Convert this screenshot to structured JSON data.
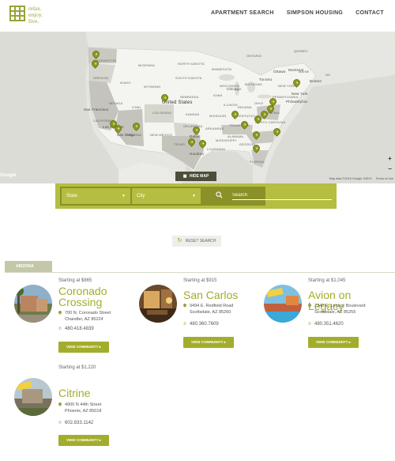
{
  "brand": {
    "logo_lines": [
      "relax.",
      "enjoy.",
      "live."
    ]
  },
  "nav": {
    "items": [
      "APARTMENT SEARCH",
      "SIMPSON HOUSING",
      "CONTACT"
    ]
  },
  "map": {
    "country_label": "United States",
    "states": [
      "WASHINGTON",
      "MONTANA",
      "NORTH DAKOTA",
      "MINNESOTA",
      "OREGON",
      "IDAHO",
      "WYOMING",
      "SOUTH DAKOTA",
      "WISCONSIN",
      "MICHIGAN",
      "NEBRASKA",
      "IOWA",
      "NEVADA",
      "UTAH",
      "COLORADO",
      "KANSAS",
      "MISSOURI",
      "ILLINOIS",
      "INDIANA",
      "OHIO",
      "PENNSYLVANIA",
      "CALIFORNIA",
      "ARIZONA",
      "NEW MEXICO",
      "OKLAHOMA",
      "ARKANSAS",
      "TENNESSEE",
      "NORTH CAROLINA",
      "TEXAS",
      "LOUISIANA",
      "MISSISSIPPI",
      "ALABAMA",
      "GEORGIA",
      "FLORIDA",
      "KENTUCKY",
      "VIRGINIA",
      "NEW YORK",
      "MAINE",
      "QUEBEC",
      "ONTARIO",
      "NS"
    ],
    "cities": [
      "San Francisco",
      "Los Angeles",
      "San Diego",
      "Dallas",
      "Houston",
      "Chicago",
      "Toronto",
      "Montreal",
      "Philadelphia",
      "New York",
      "Boston",
      "Ottawa"
    ],
    "hide_map_label": "HIDE MAP",
    "google_label": "Google",
    "attribution": "Map data ©2016 Google, INEGI",
    "terms": "Terms of Use",
    "zoom_in": "+",
    "zoom_out": "−"
  },
  "search": {
    "state_label": "State",
    "city_label": "City",
    "placeholder": "Search"
  },
  "reset_label": "RESET SEARCH",
  "region_tab": "ARIZONA",
  "listings": [
    {
      "starting": "Starting at $865",
      "name": "Coronado Crossing",
      "address1": "700 N. Coronado Street",
      "address2": "Chandler, AZ 85224",
      "phone": "480.418.4839",
      "button": "VIEW COMMUNITY ▸"
    },
    {
      "starting": "Starting at $915",
      "name": "San Carlos",
      "address1": "9494 E. Redfield Road",
      "address2": "Scottsdale, AZ 85260",
      "phone": "480.360.7609",
      "button": "VIEW COMMUNITY ▸"
    },
    {
      "starting": "Starting at $1,045",
      "name": "Avion on Legacy",
      "address1": "7340 E. Legacy Boulevard",
      "address2": "Scottsdale, AZ 85255",
      "phone": "480.351.4620",
      "button": "VIEW COMMUNITY ▸"
    },
    {
      "starting": "Starting at $1,220",
      "name": "Citrine",
      "address1": "4900 N 44th Street",
      "address2": "Phoenix, AZ 85018",
      "phone": "602.833.1142",
      "button": "VIEW COMMUNITY ▸"
    }
  ],
  "colors": {
    "accent": "#a2ad2b",
    "search_bar": "#b5be40",
    "map_bg": "#e6e6e2"
  },
  "icons": [
    "logo-grid-icon",
    "map-pin-icon",
    "search-icon",
    "reset-icon",
    "phone-icon",
    "chevron-down-icon"
  ]
}
